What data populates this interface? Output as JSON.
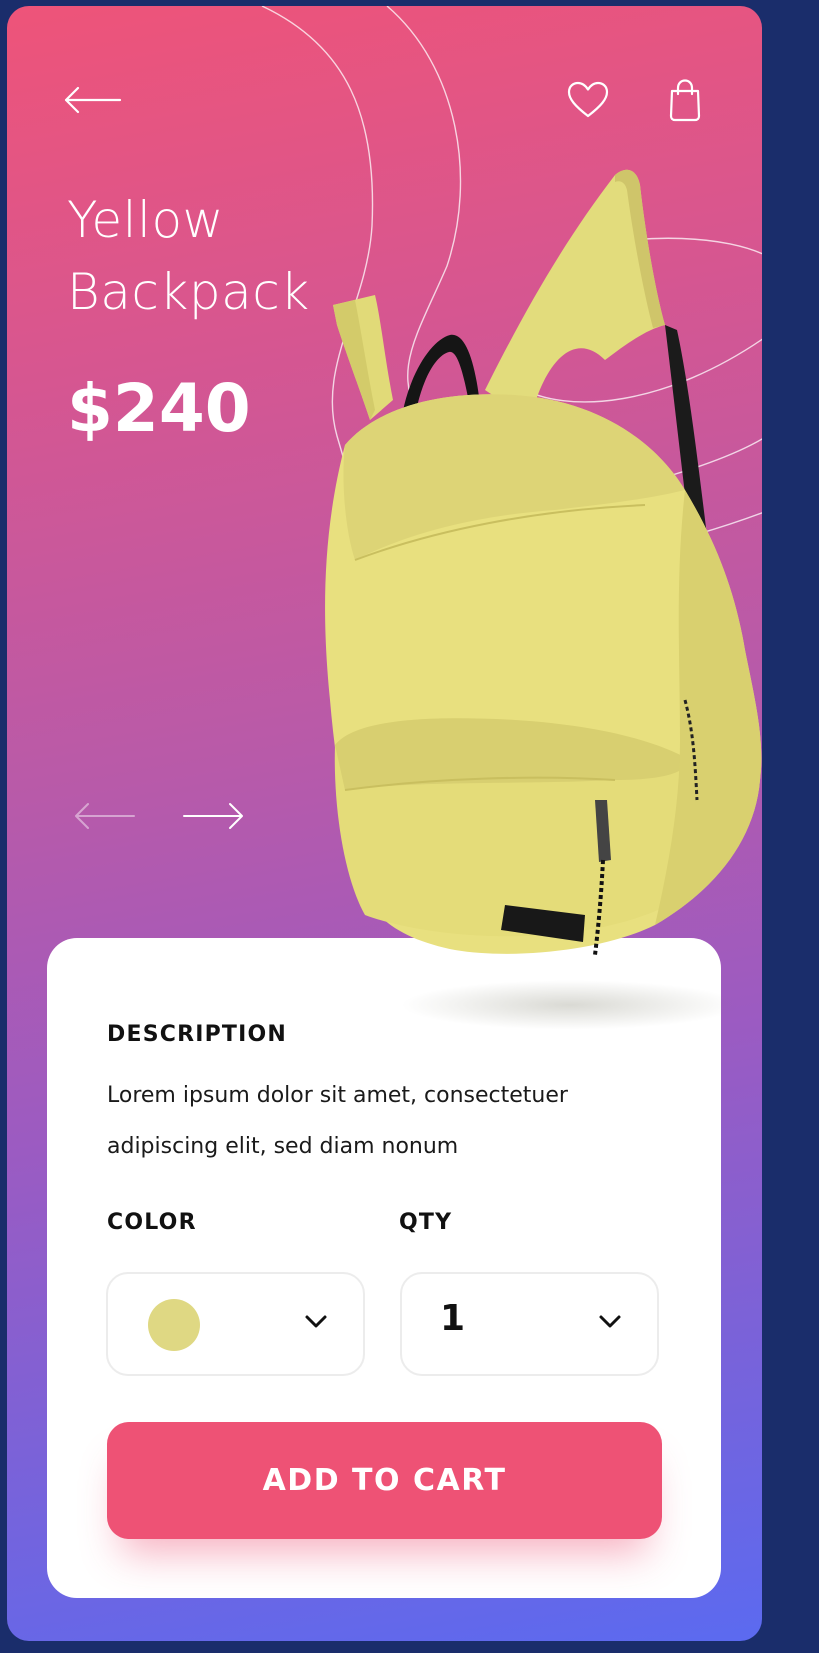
{
  "product": {
    "name_line1": "Yellow",
    "name_line2": "Backpack",
    "price": "$240",
    "image_icon": "backpack-illustration"
  },
  "header": {
    "back_icon": "arrow-left-icon",
    "favorite_icon": "heart-icon",
    "bag_icon": "shopping-bag-icon"
  },
  "carousel": {
    "prev_icon": "arrow-left-icon",
    "next_icon": "arrow-right-icon"
  },
  "details": {
    "description_label": "DESCRIPTION",
    "description_line1": "Lorem ipsum dolor sit amet, consectetuer",
    "description_line2": "adipiscing elit, sed diam nonum",
    "color_label": "COLOR",
    "qty_label": "QTY",
    "selected_color": "#dfd883",
    "qty_value": "1"
  },
  "actions": {
    "add_to_cart": "ADD TO CART"
  },
  "colors": {
    "accent": "#ee5275",
    "frame": "#1a2d6b",
    "gradient_top": "#ee5479",
    "gradient_bottom": "#5b6af0"
  }
}
